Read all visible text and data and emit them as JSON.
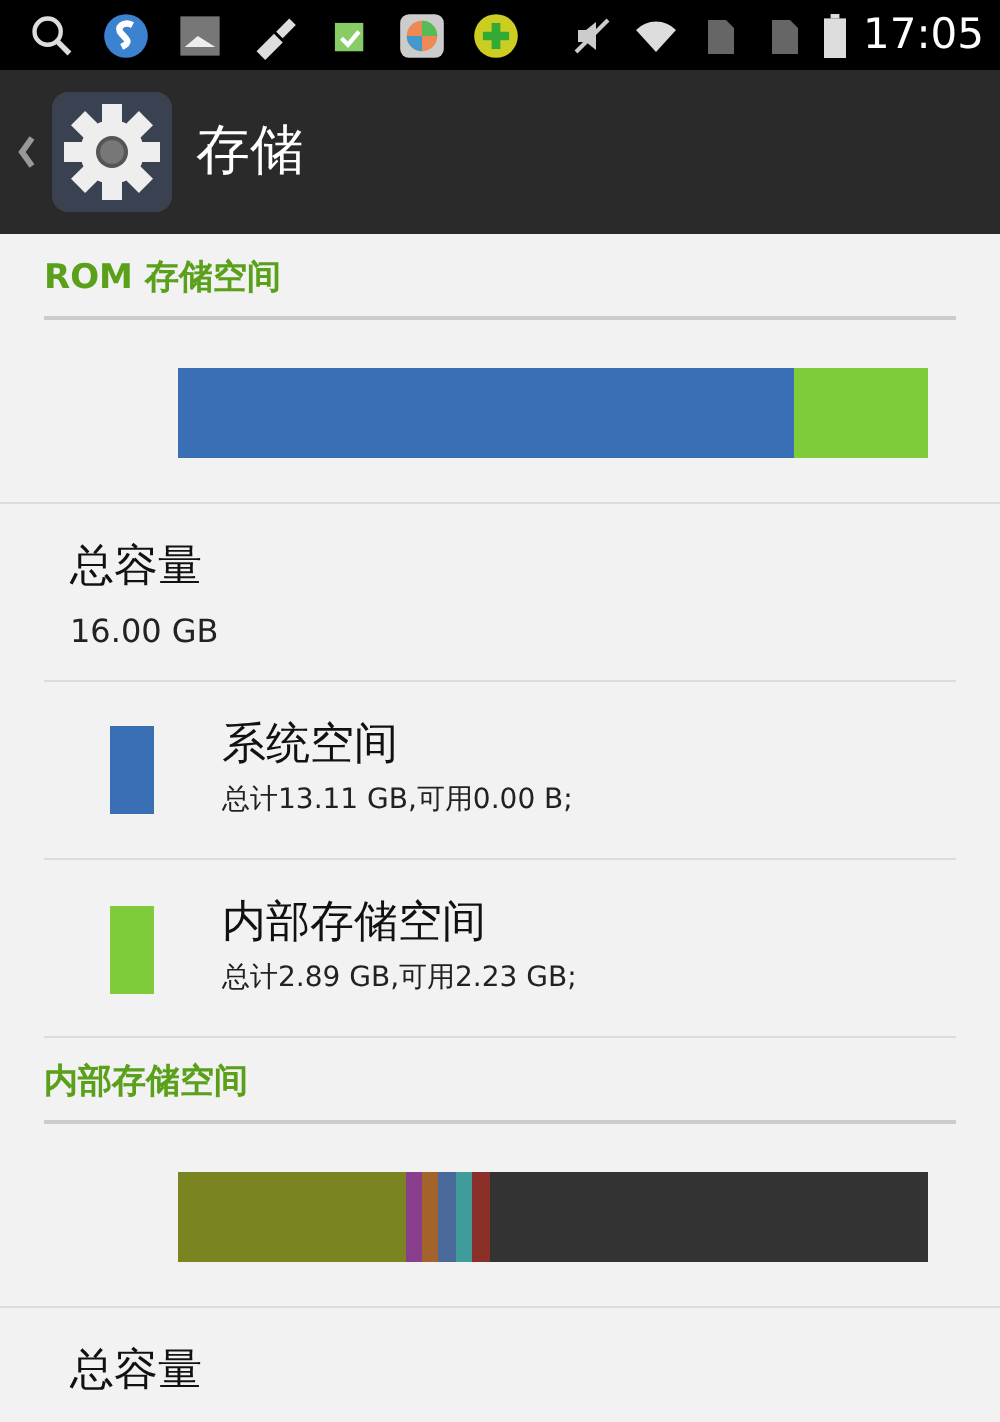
{
  "status_bar": {
    "time": "17:05"
  },
  "header": {
    "title": "存储"
  },
  "sections": [
    {
      "title": "ROM 存储空间",
      "bar": [
        {
          "color": "#3a6fb5"
        },
        {
          "color": "#7fcc3a"
        }
      ],
      "total_label": "总容量",
      "total_value": "16.00 GB",
      "items": [
        {
          "name": "系统空间",
          "detail": "总计13.11 GB,可用0.00 B;",
          "color": "#3a6fb5"
        },
        {
          "name": "内部存储空间",
          "detail": "总计2.89 GB,可用2.23 GB;",
          "color": "#7fcc3a"
        }
      ]
    },
    {
      "title": "内部存储空间",
      "bar": [
        {
          "color": "#7a8420"
        },
        {
          "color": "#8a3f8c"
        },
        {
          "color": "#a4632a"
        },
        {
          "color": "#4a6a9c"
        },
        {
          "color": "#3f9c9a"
        },
        {
          "color": "#8a3028"
        },
        {
          "color": "#333333"
        }
      ],
      "total_label": "总容量"
    }
  ]
}
